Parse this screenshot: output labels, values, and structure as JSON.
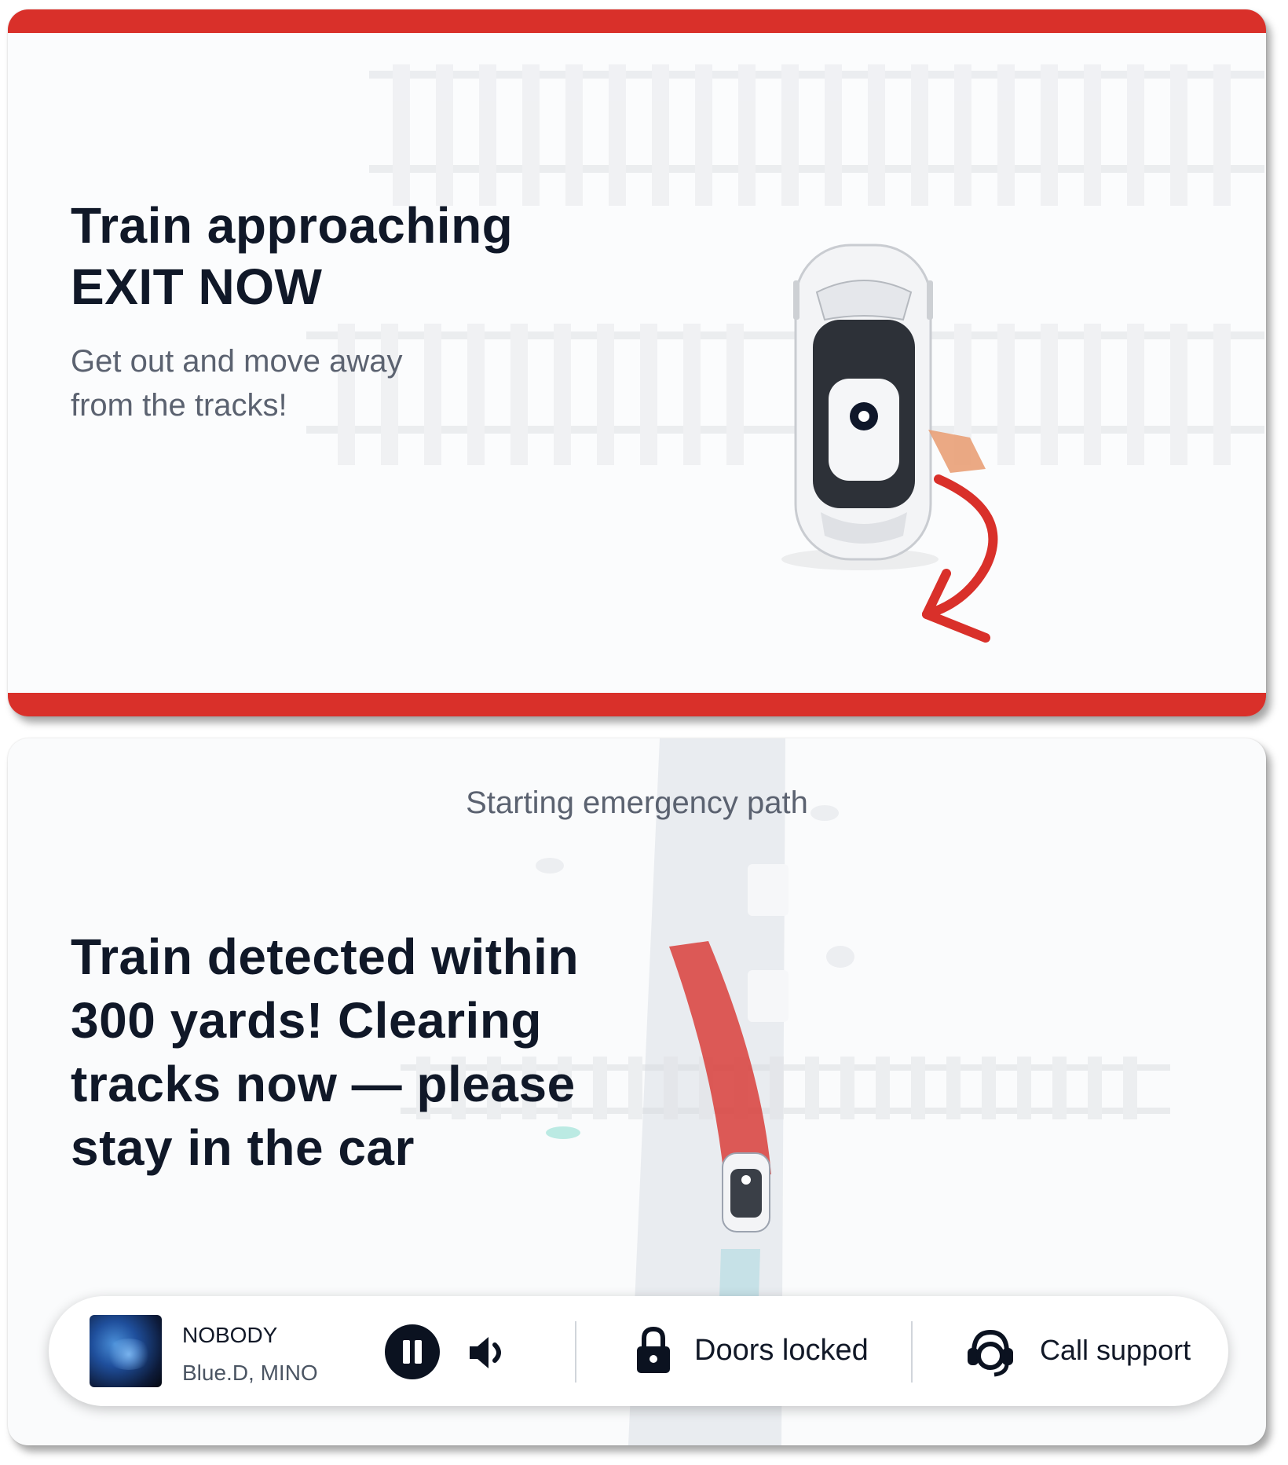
{
  "alert": {
    "title_line1": "Train approaching",
    "title_line2": "EXIT NOW",
    "subtitle_line1": "Get out and move away",
    "subtitle_line2": "from the tracks!"
  },
  "path_view": {
    "caption": "Starting emergency path",
    "message": "Train detected within 300 yards! Clearing tracks now — please stay in the car"
  },
  "media": {
    "track_title": "NOBODY",
    "artist": "Blue.D, MINO"
  },
  "controls": {
    "doors_label": "Doors locked",
    "support_label": "Call support"
  },
  "icons": {
    "pause": "pause-icon",
    "volume": "speaker-icon",
    "lock": "lock-icon",
    "support": "headset-icon"
  },
  "colors": {
    "alert_red": "#d9302a",
    "path_red": "#d9302a",
    "text_dark": "#101828",
    "text_muted": "#5b6270"
  }
}
